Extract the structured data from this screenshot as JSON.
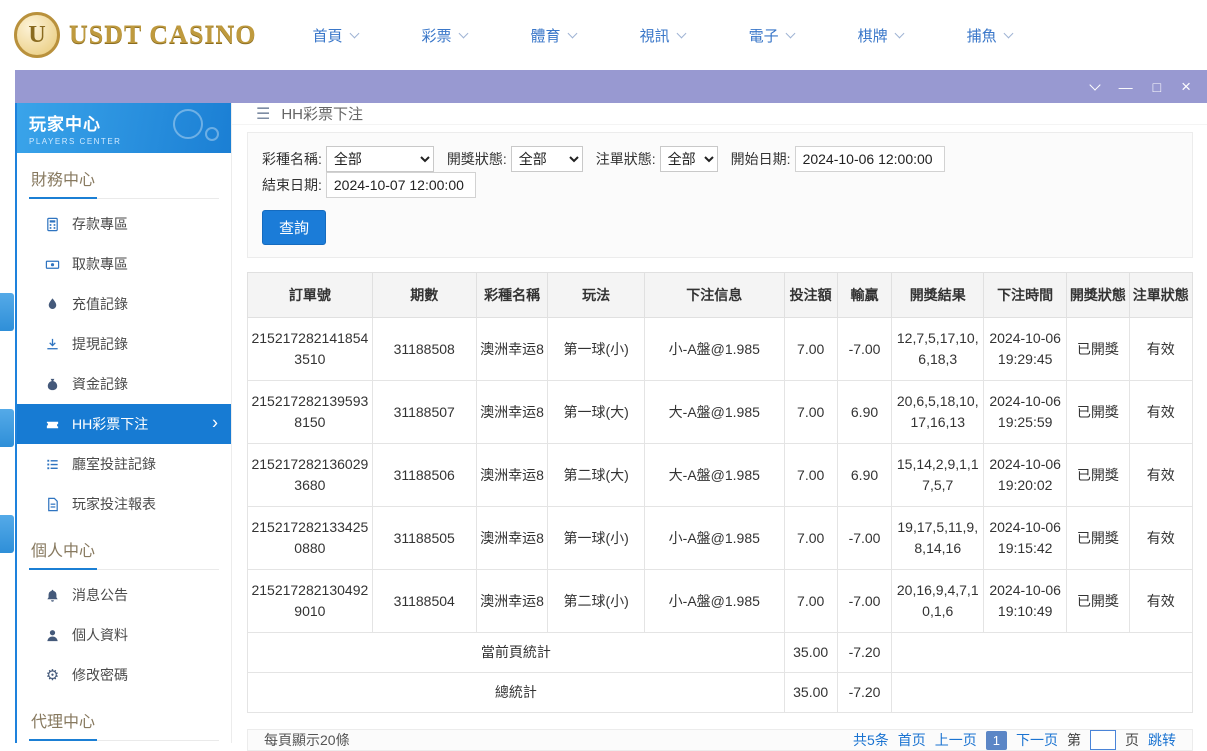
{
  "colors": {
    "accent": "#1b7fd4",
    "titlebar": "#9899d1",
    "gold": "#bf9a3e"
  },
  "topbar": {
    "logo": {
      "badge": "U",
      "text": "USDT CASINO"
    },
    "nav": [
      {
        "label": "首頁"
      },
      {
        "label": "彩票"
      },
      {
        "label": "體育"
      },
      {
        "label": "視訊"
      },
      {
        "label": "電子"
      },
      {
        "label": "棋牌"
      },
      {
        "label": "捕魚"
      }
    ]
  },
  "titlebar": {
    "minimize": "—",
    "maximize": "□",
    "close": "×"
  },
  "sidebar": {
    "title": "玩家中心",
    "subtitle": "PLAYERS CENTER",
    "sections": [
      {
        "title": "財務中心",
        "items": [
          {
            "label": "存款專區"
          },
          {
            "label": "取款專區"
          },
          {
            "label": "充值記錄"
          },
          {
            "label": "提現記錄"
          },
          {
            "label": "資金記錄"
          },
          {
            "label": "HH彩票下注"
          },
          {
            "label": "廳室投註記錄"
          },
          {
            "label": "玩家投注報表"
          }
        ]
      },
      {
        "title": "個人中心",
        "items": [
          {
            "label": "消息公告"
          },
          {
            "label": "個人資料"
          },
          {
            "label": "修改密碼"
          }
        ]
      },
      {
        "title": "代理中心",
        "items": []
      }
    ]
  },
  "main": {
    "page_head": {
      "menu_icon": "☰",
      "title": "HH彩票下注"
    },
    "filters": {
      "lottery_label": "彩種名稱:",
      "lottery_value": "全部",
      "draw_status_label": "開獎狀態:",
      "draw_status_value": "全部",
      "order_status_label": "注單狀態:",
      "order_status_value": "全部",
      "start_label": "開始日期:",
      "start_value": "2024-10-06 12:00:00",
      "end_label": "結束日期:",
      "end_value": "2024-10-07 12:00:00",
      "search_button": "查詢"
    },
    "table": {
      "headers": [
        "訂單號",
        "期數",
        "彩種名稱",
        "玩法",
        "下注信息",
        "投注額",
        "輸贏",
        "開獎結果",
        "下注時間",
        "開獎狀態",
        "注單狀態"
      ],
      "rows": [
        {
          "order_no": "2152172821418543510",
          "period": "31188508",
          "lottery": "澳洲幸运8",
          "play": "第一球(小)",
          "bet_info": "小-A盤@1.985",
          "bet_amount": "7.00",
          "winloss": "-7.00",
          "result": "12,7,5,17,10,6,18,3",
          "bet_time": "2024-10-06 19:29:45",
          "draw_status": "已開獎",
          "order_status": "有效"
        },
        {
          "order_no": "2152172821395938150",
          "period": "31188507",
          "lottery": "澳洲幸运8",
          "play": "第一球(大)",
          "bet_info": "大-A盤@1.985",
          "bet_amount": "7.00",
          "winloss": "6.90",
          "result": "20,6,5,18,10,17,16,13",
          "bet_time": "2024-10-06 19:25:59",
          "draw_status": "已開獎",
          "order_status": "有效"
        },
        {
          "order_no": "2152172821360293680",
          "period": "31188506",
          "lottery": "澳洲幸运8",
          "play": "第二球(大)",
          "bet_info": "大-A盤@1.985",
          "bet_amount": "7.00",
          "winloss": "6.90",
          "result": "15,14,2,9,1,17,5,7",
          "bet_time": "2024-10-06 19:20:02",
          "draw_status": "已開獎",
          "order_status": "有效"
        },
        {
          "order_no": "2152172821334250880",
          "period": "31188505",
          "lottery": "澳洲幸运8",
          "play": "第一球(小)",
          "bet_info": "小-A盤@1.985",
          "bet_amount": "7.00",
          "winloss": "-7.00",
          "result": "19,17,5,11,9,8,14,16",
          "bet_time": "2024-10-06 19:15:42",
          "draw_status": "已開獎",
          "order_status": "有效"
        },
        {
          "order_no": "2152172821304929010",
          "period": "31188504",
          "lottery": "澳洲幸运8",
          "play": "第二球(小)",
          "bet_info": "小-A盤@1.985",
          "bet_amount": "7.00",
          "winloss": "-7.00",
          "result": "20,16,9,4,7,10,1,6",
          "bet_time": "2024-10-06 19:10:49",
          "draw_status": "已開獎",
          "order_status": "有效"
        }
      ],
      "page_summary": {
        "label": "當前頁統計",
        "bet_amount": "35.00",
        "winloss": "-7.20"
      },
      "total_summary": {
        "label": "總統計",
        "bet_amount": "35.00",
        "winloss": "-7.20"
      }
    },
    "footer": {
      "page_size_text": "每頁顯示20條",
      "total_text": "共5条",
      "first": "首页",
      "prev": "上一页",
      "current_page": "1",
      "next": "下一页",
      "jump_prefix": "第",
      "jump_suffix": "页",
      "jump_action": "跳转"
    }
  }
}
